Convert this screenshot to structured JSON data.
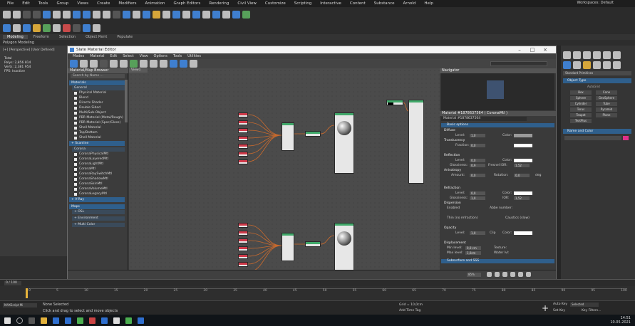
{
  "app": {
    "menu": [
      "File",
      "Edit",
      "Tools",
      "Group",
      "Views",
      "Create",
      "Modifiers",
      "Animation",
      "Graph Editors",
      "Rendering",
      "Civil View",
      "Customize",
      "Scripting",
      "Interactive",
      "Content",
      "Substance",
      "Arnold",
      "Help"
    ],
    "workspace": "Workspaces: Default",
    "ribbon_tabs": [
      "Modeling",
      "Freeform",
      "Selection",
      "Object Paint",
      "Populate"
    ],
    "ribbon_sub": "Polygon Modeling",
    "viewport_label": "[+] [Perspective] [User Defined]",
    "viewport_stats": [
      "Total",
      "Polys: 2,856 814",
      "Verts: 2,381 954",
      "FPS: Inactive"
    ]
  },
  "slate": {
    "title": "Slate Material Editor",
    "menu": [
      "Modes",
      "Material",
      "Edit",
      "Select",
      "View",
      "Options",
      "Tools",
      "Utilities"
    ],
    "browser": {
      "title": "Material/Map Browser",
      "search": "Search by Name ...",
      "cat_materials": "Materials",
      "sub_general": "General",
      "general": [
        "Physical Material",
        "Blend",
        "Directx Shader",
        "Double Sided",
        "Multi/Sub-Object",
        "PBR Material (Metal/Rough)",
        "PBR Material (Spec/Gloss)",
        "Shell Material",
        "Top/Bottom",
        "Shell Material"
      ],
      "cat_scanline": "+ Scanline",
      "sub_corona": "Corona",
      "corona": [
        "CoronaPhysicalMtl",
        "CoronaLayeredMtl",
        "CoronaLightMtl",
        "CoronaMtl",
        "CoronaRaySwitchMtl",
        "CoronaShadowMtl",
        "CoronaSkinMtl",
        "CoronaVolumeMtl",
        "CoronaLegacyMtl"
      ],
      "cat_vray": "+ V-Ray",
      "cat_maps": "Maps",
      "maps": [
        "+ OSL",
        "+ Environment",
        "+ Multi Color"
      ]
    },
    "view_tab": "View1",
    "navigator": "Navigator",
    "mtl_title": "Material #1878637564  ( CoronaMtl )",
    "mtl_name": "Material #1878637564",
    "groups": {
      "basic": "Basic options",
      "props": "Advanced options",
      "maps": "Maps",
      "maps2": "Subsurface and SSS"
    },
    "params": {
      "diffuse": "Diffuse",
      "d_level": "Level:",
      "d_level_v": "1,0",
      "d_color": "Color:",
      "translucency": "Translucency",
      "fraction": "Fraction:",
      "fraction_v": "0,0",
      "reflection": "Reflection",
      "r_level_v": "0,0",
      "glossiness": "Glossiness:",
      "glossiness_v": "0,9",
      "fresnel": "Fresnel IOR:",
      "fresnel_v": "1,52",
      "anisotropy": "Anisotropy",
      "amount": "Amount:",
      "amount_v": "0,0",
      "rotation": "Rotation:",
      "rotation_v": "0,0",
      "deg": "deg",
      "refraction": "Refraction",
      "rf_level_v": "0,0",
      "ior": "IOR:",
      "ior_v": "1,52",
      "rf_gloss_v": "1,0",
      "dispersion": "Dispersion",
      "enabled": "Enabled",
      "abbe": "Abbe number:",
      "thin": "Thin (no refraction)",
      "caustics": "Caustics (slow)",
      "opacity": "Opacity",
      "op_level_v": "1,0",
      "clip": "Clip",
      "displacement": "Displacement",
      "min_level": "Min level:",
      "min_v": "0,0 cm",
      "texture": "Texture:",
      "max_level": "Max level:",
      "max_v": "1,0cm",
      "water": "Water lvl:"
    },
    "zoom": "85%"
  },
  "cmd": {
    "object_type": "Object Type",
    "autogrid": "AutoGrid",
    "objects": [
      "Box",
      "Cone",
      "Sphere",
      "GeoSphere",
      "Cylinder",
      "Tube",
      "Torus",
      "Pyramid",
      "Teapot",
      "Plane",
      "TextPlus"
    ],
    "name_color": "Name and Color",
    "std_prims": "Standard Primitives"
  },
  "timeline": {
    "frame": "0 / 100",
    "ticks": [
      "0",
      "5",
      "10",
      "15",
      "20",
      "25",
      "30",
      "35",
      "40",
      "45",
      "50",
      "55",
      "60",
      "65",
      "70",
      "75",
      "80",
      "85",
      "90",
      "95",
      "100"
    ]
  },
  "status": {
    "selected": "None Selected",
    "hint": "Click and drag to select and move objects",
    "grid": "Grid = 10,0cm",
    "add_time": "Add Time Tag",
    "auto_key": "Auto Key",
    "set_key": "Set Key",
    "selected_lbl": "Selected",
    "key_filters": "Key Filters...",
    "maxscript": "MAXScript Mi"
  },
  "clock": {
    "time": "14:51",
    "date": "10.05.2021"
  },
  "colors": {
    "accent": "#2f5f8c",
    "wire": "#c96a2d",
    "green_header": "#41a96a",
    "red_header": "#d13a4a"
  }
}
